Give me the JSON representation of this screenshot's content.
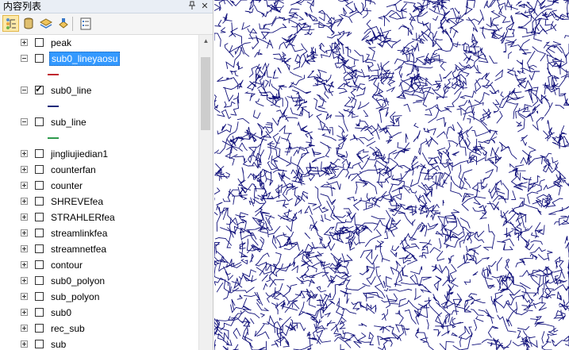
{
  "panel": {
    "title": "内容列表",
    "pin_glyph": "📌",
    "close_glyph": "✕",
    "toolbar": [
      {
        "name": "list-by-drawing-order-button",
        "icon": "list-by-drawing-order-icon",
        "active": true
      },
      {
        "name": "list-by-source-button",
        "icon": "list-by-source-icon",
        "active": false
      },
      {
        "name": "list-by-visibility-button",
        "icon": "list-by-visibility-icon",
        "active": false
      },
      {
        "name": "list-by-selection-button",
        "icon": "list-by-selection-icon",
        "active": false
      },
      {
        "name": "options-button",
        "icon": "options-icon",
        "active": false
      }
    ]
  },
  "layers": [
    {
      "name": "peak",
      "checked": false,
      "expanded": false,
      "selected": false
    },
    {
      "name": "sub0_lineyaosu",
      "checked": false,
      "expanded": true,
      "selected": true,
      "symbol_color": "#c0262e"
    },
    {
      "name": "sub0_line",
      "checked": true,
      "expanded": true,
      "selected": false,
      "symbol_color": "#1f2a7a"
    },
    {
      "name": "sub_line",
      "checked": false,
      "expanded": true,
      "selected": false,
      "symbol_color": "#2e9a4c"
    },
    {
      "name": "jingliujiedian1",
      "checked": false,
      "expanded": false,
      "selected": false
    },
    {
      "name": "counterfan",
      "checked": false,
      "expanded": false,
      "selected": false
    },
    {
      "name": "counter",
      "checked": false,
      "expanded": false,
      "selected": false
    },
    {
      "name": "SHREVEfea",
      "checked": false,
      "expanded": false,
      "selected": false
    },
    {
      "name": "STRAHLERfea",
      "checked": false,
      "expanded": false,
      "selected": false
    },
    {
      "name": "streamlinkfea",
      "checked": false,
      "expanded": false,
      "selected": false
    },
    {
      "name": "streamnetfea",
      "checked": false,
      "expanded": false,
      "selected": false
    },
    {
      "name": "contour",
      "checked": false,
      "expanded": false,
      "selected": false
    },
    {
      "name": "sub0_polyon",
      "checked": false,
      "expanded": false,
      "selected": false
    },
    {
      "name": "sub_polyon",
      "checked": false,
      "expanded": false,
      "selected": false
    },
    {
      "name": "sub0",
      "checked": false,
      "expanded": false,
      "selected": false
    },
    {
      "name": "rec_sub",
      "checked": false,
      "expanded": false,
      "selected": false
    },
    {
      "name": "sub",
      "checked": false,
      "expanded": false,
      "selected": false
    }
  ],
  "map": {
    "line_color": "#10107a",
    "background": "#ffffff"
  }
}
